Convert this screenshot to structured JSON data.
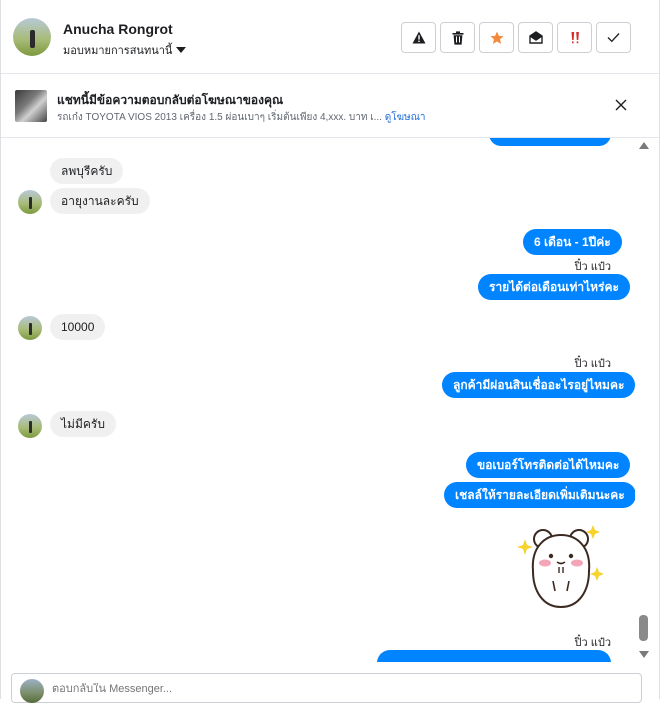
{
  "header": {
    "name": "Anucha Rongrot",
    "assign_label": "มอบหมายการสนทนานี้",
    "toolbar": [
      {
        "icon": "warning-icon",
        "label": "Report"
      },
      {
        "icon": "trash-icon",
        "label": "Delete"
      },
      {
        "icon": "star-icon",
        "label": "Star"
      },
      {
        "icon": "mail-open-icon",
        "label": "Mark as unread"
      },
      {
        "icon": "spam-icon",
        "label": "Spam"
      },
      {
        "icon": "check-icon",
        "label": "Done"
      }
    ]
  },
  "ad_banner": {
    "title": "แชทนี้มีข้อความตอบกลับต่อโฆษณาของคุณ",
    "description": "รถเก๋ง TOYOTA VIOS 2013 เครื่อง 1.5 ผ่อนเบาๆ เริ่มต้นเพียง 4,xxx. บาท เ...",
    "link_label": "ดูโฆษณา"
  },
  "colors": {
    "outgoing_bubble": "#0084ff",
    "incoming_bubble": "#f1f0f0",
    "accent_link": "#216fdb",
    "star": "#f5893b"
  },
  "messages": [
    {
      "direction": "out",
      "text": ""
    },
    {
      "direction": "in",
      "text": "ลพบุรีครับ"
    },
    {
      "direction": "in",
      "text": "อายุงานละครับ"
    },
    {
      "direction": "out",
      "text": "6 เดือน - 1ปีค่ะ"
    },
    {
      "direction": "out",
      "sender": "ปิ๋ว แป๋ว",
      "text": "รายได้ต่อเดือนเท่าไหร่คะ"
    },
    {
      "direction": "in",
      "text": "10000"
    },
    {
      "direction": "out",
      "sender": "ปิ๋ว แป๋ว",
      "text": "ลูกค้ามีผ่อนสินเชื่ออะไรอยู่ไหมคะ"
    },
    {
      "direction": "in",
      "text": "ไม่มีครับ"
    },
    {
      "direction": "out",
      "text": "ขอเบอร์โทรติดต่อได้ไหมคะ"
    },
    {
      "direction": "out",
      "text": "เชลล์ให้รายละเอียดเพิ่มเติมนะคะ"
    },
    {
      "direction": "out",
      "sticker": "hamster-sticker"
    },
    {
      "direction": "out",
      "sender": "ปิ๋ว แป๋ว",
      "text": ""
    }
  ],
  "composer": {
    "placeholder": "ตอบกลับใน Messenger..."
  }
}
